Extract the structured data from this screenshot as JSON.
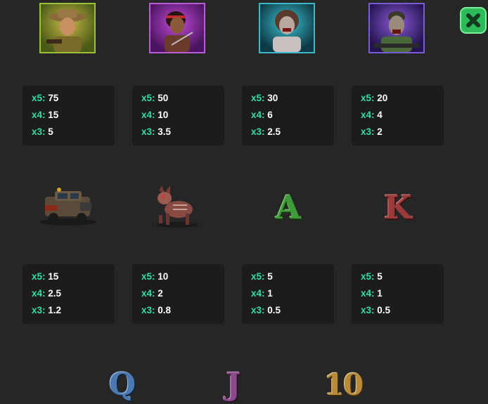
{
  "close_button": {
    "icon": "close-x-icon",
    "color": "#2dbb5a"
  },
  "symbols_row1": [
    {
      "name": "hunter",
      "icon": "hunter-portrait-icon",
      "frame_color": "#9bc13a",
      "pays": [
        {
          "key": "x5:",
          "value": "75"
        },
        {
          "key": "x4:",
          "value": "15"
        },
        {
          "key": "x3:",
          "value": "5"
        }
      ]
    },
    {
      "name": "woman",
      "icon": "woman-portrait-icon",
      "frame_color": "#b85bd6",
      "pays": [
        {
          "key": "x5:",
          "value": "50"
        },
        {
          "key": "x4:",
          "value": "10"
        },
        {
          "key": "x3:",
          "value": "3.5"
        }
      ]
    },
    {
      "name": "zombie-woman",
      "icon": "zombie-woman-portrait-icon",
      "frame_color": "#3fb9c9",
      "pays": [
        {
          "key": "x5:",
          "value": "30"
        },
        {
          "key": "x4:",
          "value": "6"
        },
        {
          "key": "x3:",
          "value": "2.5"
        }
      ]
    },
    {
      "name": "zombie-man",
      "icon": "zombie-man-portrait-icon",
      "frame_color": "#7a5bd6",
      "pays": [
        {
          "key": "x5:",
          "value": "20"
        },
        {
          "key": "x4:",
          "value": "4"
        },
        {
          "key": "x3:",
          "value": "2"
        }
      ]
    }
  ],
  "symbols_row2": [
    {
      "name": "truck",
      "icon": "armored-truck-icon",
      "pays": [
        {
          "key": "x5:",
          "value": "15"
        },
        {
          "key": "x4:",
          "value": "2.5"
        },
        {
          "key": "x3:",
          "value": "1.2"
        }
      ]
    },
    {
      "name": "zombie-dog",
      "icon": "zombie-dog-icon",
      "pays": [
        {
          "key": "x5:",
          "value": "10"
        },
        {
          "key": "x4:",
          "value": "2"
        },
        {
          "key": "x3:",
          "value": "0.8"
        }
      ]
    },
    {
      "name": "letter-a",
      "icon": "letter-a-icon",
      "glyph": "A",
      "color": "#3f9a3a",
      "pays": [
        {
          "key": "x5:",
          "value": "5"
        },
        {
          "key": "x4:",
          "value": "1"
        },
        {
          "key": "x3:",
          "value": "0.5"
        }
      ]
    },
    {
      "name": "letter-k",
      "icon": "letter-k-icon",
      "glyph": "K",
      "color": "#9a3a3a",
      "pays": [
        {
          "key": "x5:",
          "value": "5"
        },
        {
          "key": "x4:",
          "value": "1"
        },
        {
          "key": "x3:",
          "value": "0.5"
        }
      ]
    }
  ],
  "symbols_row3": [
    {
      "name": "letter-q",
      "icon": "letter-q-icon",
      "glyph": "Q",
      "color": "#4a78b0"
    },
    {
      "name": "letter-j",
      "icon": "letter-j-icon",
      "glyph": "J",
      "color": "#8a4a8a"
    },
    {
      "name": "number-10",
      "icon": "number-10-icon",
      "glyph": "10",
      "color": "#b88a3a"
    }
  ]
}
